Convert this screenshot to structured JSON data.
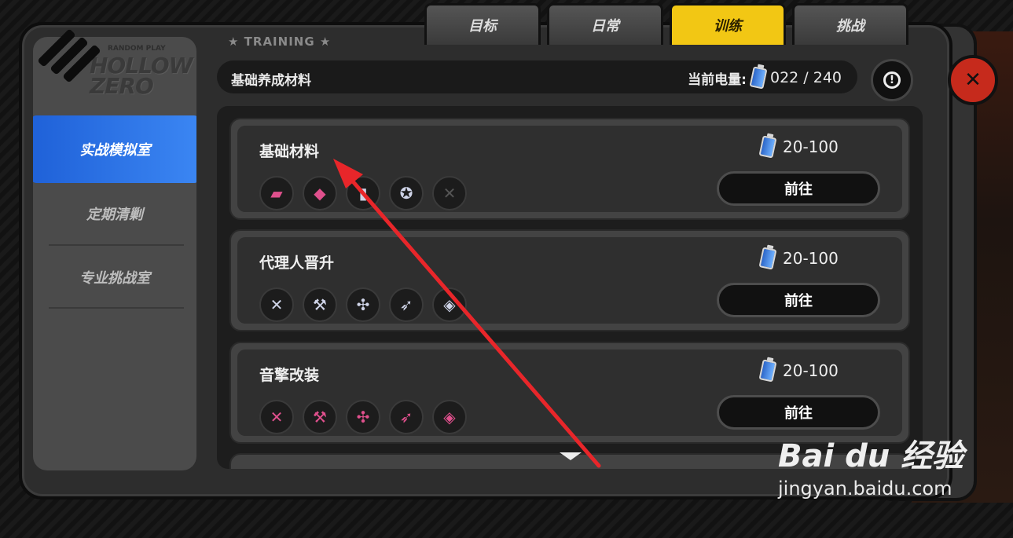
{
  "tabs": [
    {
      "label": "目标",
      "active": false
    },
    {
      "label": "日常",
      "active": false
    },
    {
      "label": "训练",
      "active": true
    },
    {
      "label": "挑战",
      "active": false
    }
  ],
  "sidebar": {
    "logo_small": "RANDOM PLAY",
    "logo": "HOLLOW ZERO",
    "items": [
      {
        "label": "实战模拟室",
        "active": true
      },
      {
        "label": "定期清剿",
        "active": false
      },
      {
        "label": "专业挑战室",
        "active": false
      }
    ]
  },
  "header": {
    "section": "★ TRAINING ★",
    "title": "基础养成材料",
    "energy_label": "当前电量:",
    "energy_value": "022 / 240"
  },
  "cards": [
    {
      "title": "基础材料",
      "cost": "20-100",
      "button": "前往",
      "icons": [
        "car-icon",
        "disk-icon",
        "bottle-icon",
        "star-coin-icon",
        "locked-icon"
      ]
    },
    {
      "title": "代理人晋升",
      "cost": "20-100",
      "button": "前往",
      "icons": [
        "sword-icon",
        "hammer-icon",
        "fan-icon",
        "bullet-icon",
        "shield-icon"
      ]
    },
    {
      "title": "音擎改装",
      "cost": "20-100",
      "button": "前往",
      "icons": [
        "sword-icon",
        "hammer-icon",
        "fan-icon",
        "bullet-icon",
        "shield-icon"
      ]
    }
  ],
  "watermark": {
    "brand": "Bai du 经验",
    "url": "jingyan.baidu.com"
  },
  "colors": {
    "tab_active": "#f2c714",
    "sidebar_active": "#2f78ec",
    "close": "#c62a1c",
    "annotation": "#e8262a"
  }
}
